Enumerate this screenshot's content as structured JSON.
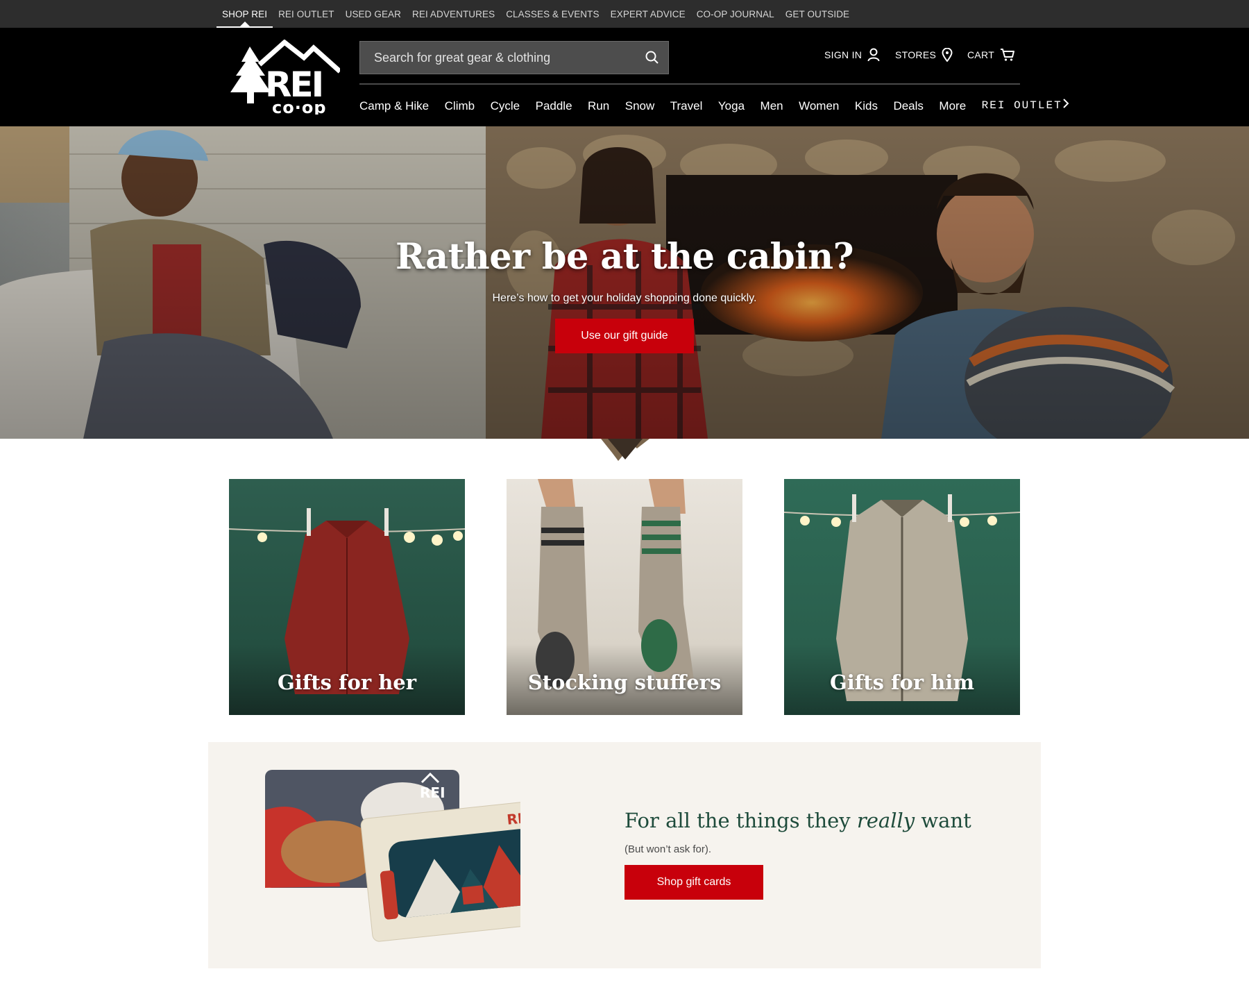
{
  "utility_nav": [
    {
      "label": "SHOP REI",
      "active": true
    },
    {
      "label": "REI OUTLET"
    },
    {
      "label": "USED GEAR"
    },
    {
      "label": "REI ADVENTURES"
    },
    {
      "label": "CLASSES & EVENTS"
    },
    {
      "label": "EXPERT ADVICE"
    },
    {
      "label": "CO-OP JOURNAL"
    },
    {
      "label": "GET OUTSIDE"
    }
  ],
  "header": {
    "logo_text": "REI co-op",
    "search": {
      "placeholder": "Search for great gear & clothing",
      "icon": "search-icon"
    },
    "account": {
      "sign_in": "SIGN IN",
      "stores": "STORES",
      "cart": "CART"
    }
  },
  "main_nav": [
    "Camp & Hike",
    "Climb",
    "Cycle",
    "Paddle",
    "Run",
    "Snow",
    "Travel",
    "Yoga",
    "Men",
    "Women",
    "Kids",
    "Deals",
    "More"
  ],
  "outlet_link": {
    "label": "REI OUTLET",
    "icon": "chevron-right-icon"
  },
  "hero": {
    "title": "Rather be at the cabin?",
    "subtitle": "Here’s how to get your holiday shopping done quickly.",
    "cta": "Use our gift guide"
  },
  "tiles": [
    {
      "label": "Gifts for her"
    },
    {
      "label": "Stocking stuffers"
    },
    {
      "label": "Gifts for him"
    }
  ],
  "gift_card_promo": {
    "title_before": "For all the things they ",
    "title_emphasis": "really",
    "title_after": " want",
    "subtitle": "(But won’t ask for).",
    "cta": "Shop gift cards"
  },
  "colors": {
    "brand_red": "#c8000b",
    "header_black": "#000000",
    "utility_gray": "#2d2d2d",
    "promo_green": "#1e4b3b",
    "tile_green": "#245c4a"
  }
}
